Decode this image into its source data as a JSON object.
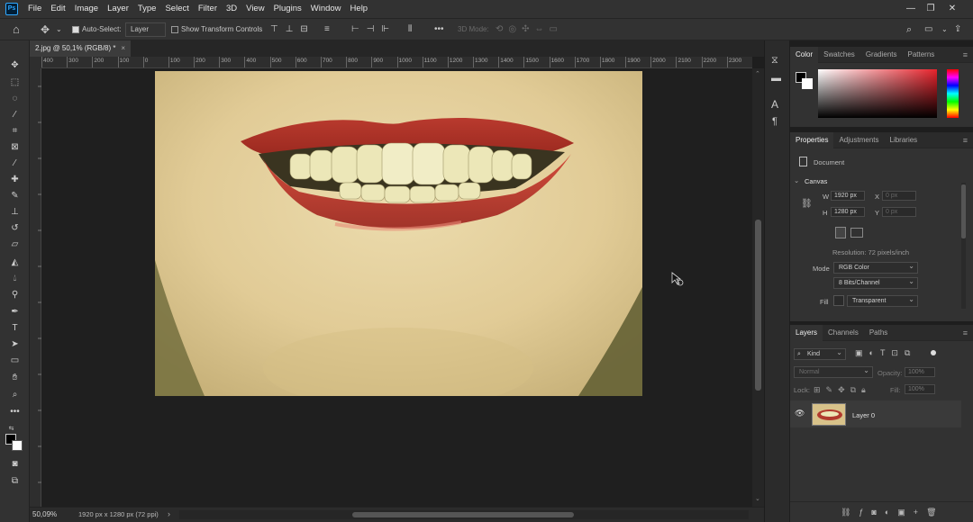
{
  "app": {
    "logo": "Ps"
  },
  "menu": [
    "File",
    "Edit",
    "Image",
    "Layer",
    "Type",
    "Select",
    "Filter",
    "3D",
    "View",
    "Plugins",
    "Window",
    "Help"
  ],
  "options": {
    "auto_select_label": "Auto-Select:",
    "auto_select_target": "Layer",
    "show_transform_label": "Show Transform Controls",
    "mode_3d_label": "3D Mode:",
    "more": "•••"
  },
  "document": {
    "tab_title": "2.jpg @ 50,1% (RGB/8) *",
    "tab_close": "×"
  },
  "ruler": {
    "h_ticks": [
      "400",
      "300",
      "200",
      "100",
      "0",
      "100",
      "200",
      "300",
      "400",
      "500",
      "600",
      "700",
      "800",
      "900",
      "1000",
      "1100",
      "1200",
      "1300",
      "1400",
      "1500",
      "1600",
      "1700",
      "1800",
      "1900",
      "2000",
      "2100",
      "2200",
      "2300"
    ]
  },
  "status": {
    "zoom": "50,09%",
    "info": "1920 px x 1280 px (72 ppi)",
    "arrow": "›"
  },
  "color_panel": {
    "tabs": [
      "Color",
      "Swatches",
      "Gradients",
      "Patterns"
    ],
    "accent": "#e8232c"
  },
  "properties_panel": {
    "tabs": [
      "Properties",
      "Adjustments",
      "Libraries"
    ],
    "doc_label": "Document",
    "canvas_label": "Canvas",
    "w_label": "W",
    "w_value": "1920 px",
    "h_label": "H",
    "h_value": "1280 px",
    "x_label": "X",
    "x_value": "0 px",
    "y_label": "Y",
    "y_value": "0 px",
    "resolution": "Resolution: 72 pixels/inch",
    "mode_label": "Mode",
    "mode_value": "RGB Color",
    "bits_value": "8 Bits/Channel",
    "fill_label": "Fill",
    "fill_value": "Transparent"
  },
  "layers_panel": {
    "tabs": [
      "Layers",
      "Channels",
      "Paths"
    ],
    "kind_label": "Kind",
    "blend_mode": "Normal",
    "opacity_label": "Opacity:",
    "opacity_value": "100%",
    "lock_label": "Lock:",
    "fill_label": "Fill:",
    "fill_value": "100%",
    "layers": [
      {
        "name": "Layer 0"
      }
    ]
  }
}
